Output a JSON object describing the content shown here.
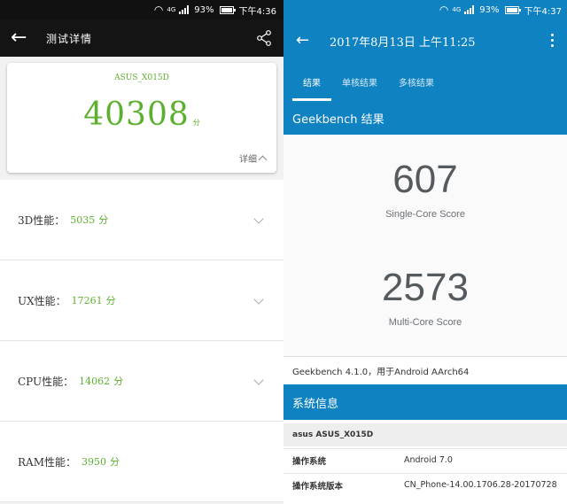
{
  "left": {
    "status": {
      "battery": "93%",
      "time": "下午4:36",
      "network": "4G"
    },
    "header": {
      "title": "测试详情"
    },
    "score_card": {
      "device": "ASUS_X015D",
      "total": "40308",
      "unit": "分",
      "detail_label": "详细"
    },
    "items": [
      {
        "label": "3D性能：",
        "value": "5035",
        "unit": "分"
      },
      {
        "label": "UX性能：",
        "value": "17261",
        "unit": "分"
      },
      {
        "label": "CPU性能：",
        "value": "14062",
        "unit": "分"
      },
      {
        "label": "RAM性能：",
        "value": "3950",
        "unit": "分"
      }
    ]
  },
  "right": {
    "status": {
      "battery": "93%",
      "time": "下午4:37",
      "network": "4G"
    },
    "header": {
      "title": "2017年8月13日 上午11:25"
    },
    "tabs": [
      {
        "label": "结果"
      },
      {
        "label": "单核结果"
      },
      {
        "label": "多核结果"
      }
    ],
    "section_title": "Geekbench 结果",
    "single": {
      "score": "607",
      "label": "Single-Core Score"
    },
    "multi": {
      "score": "2573",
      "label": "Multi-Core Score"
    },
    "version": "Geekbench 4.1.0，用于Android AArch64",
    "sysinfo": {
      "title": "系统信息",
      "device": "asus ASUS_X015D",
      "rows": [
        {
          "key": "操作系统",
          "value": "Android 7.0"
        },
        {
          "key": "操作系统版本",
          "value": "CN_Phone-14.00.1706.28-20170728"
        }
      ]
    }
  },
  "colors": {
    "antutu_green": "#5db02e",
    "geekbench_blue": "#0f82c2"
  },
  "icons": {
    "back": "arrow-left-icon",
    "share": "share-icon",
    "more": "more-vert-icon",
    "expand": "chevron-down-icon",
    "collapse": "chevron-up-icon"
  }
}
